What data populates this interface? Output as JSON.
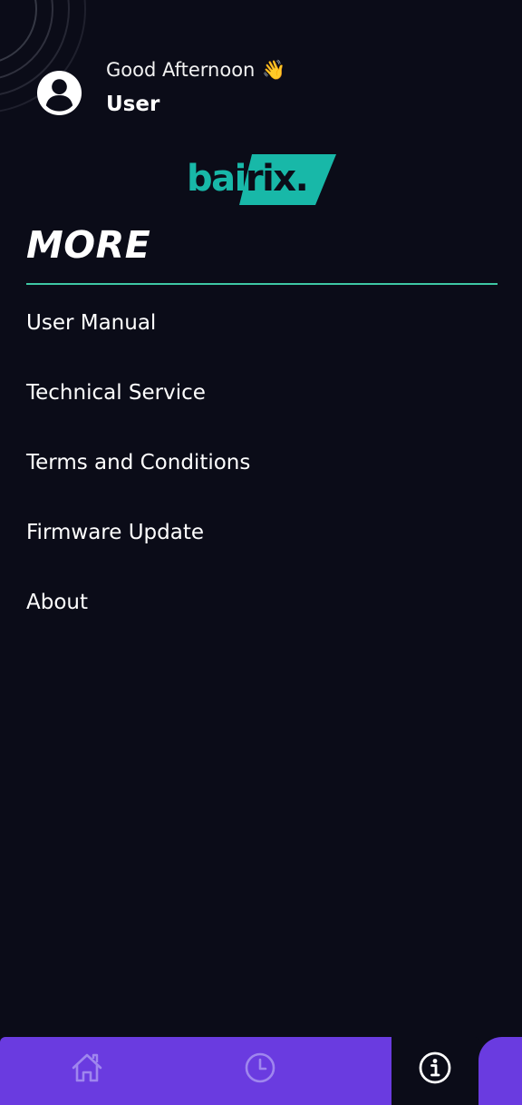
{
  "header": {
    "greeting": "Good Afternoon",
    "wave_emoji": "👋",
    "username": "User",
    "avatar_icon": "user-circle-icon"
  },
  "logo": {
    "part1": "bai",
    "part2": "rix.",
    "color": "#18b8a8"
  },
  "page": {
    "title": "MORE"
  },
  "menu": {
    "items": [
      {
        "label": "User Manual"
      },
      {
        "label": "Technical Service"
      },
      {
        "label": "Terms and Conditions"
      },
      {
        "label": "Firmware Update"
      },
      {
        "label": "About"
      }
    ]
  },
  "bottom_nav": {
    "items": [
      {
        "icon": "home-icon",
        "active": false
      },
      {
        "icon": "clock-icon",
        "active": false
      },
      {
        "icon": "info-icon",
        "active": true
      }
    ]
  },
  "colors": {
    "background": "#0b0c18",
    "accent": "#3ec8a4",
    "nav": "#6a3be0",
    "brand": "#18b8a8"
  }
}
